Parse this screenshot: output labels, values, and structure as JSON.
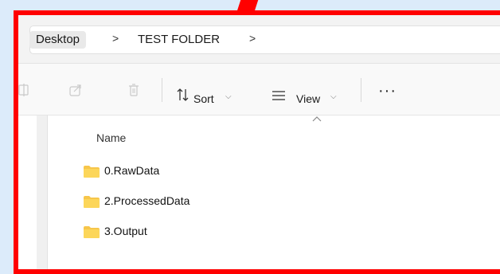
{
  "breadcrumb": {
    "items": [
      "Desktop",
      "TEST FOLDER"
    ],
    "separator": ">"
  },
  "toolbar": {
    "sort_label": "Sort",
    "view_label": "View",
    "more_label": "···"
  },
  "list": {
    "column_header": "Name",
    "items": [
      "0.RawData",
      "2.ProcessedData",
      "3.Output"
    ]
  },
  "colors": {
    "frame": "#ff0000",
    "background": "#dcebfa",
    "folder": "#f7c64b"
  }
}
